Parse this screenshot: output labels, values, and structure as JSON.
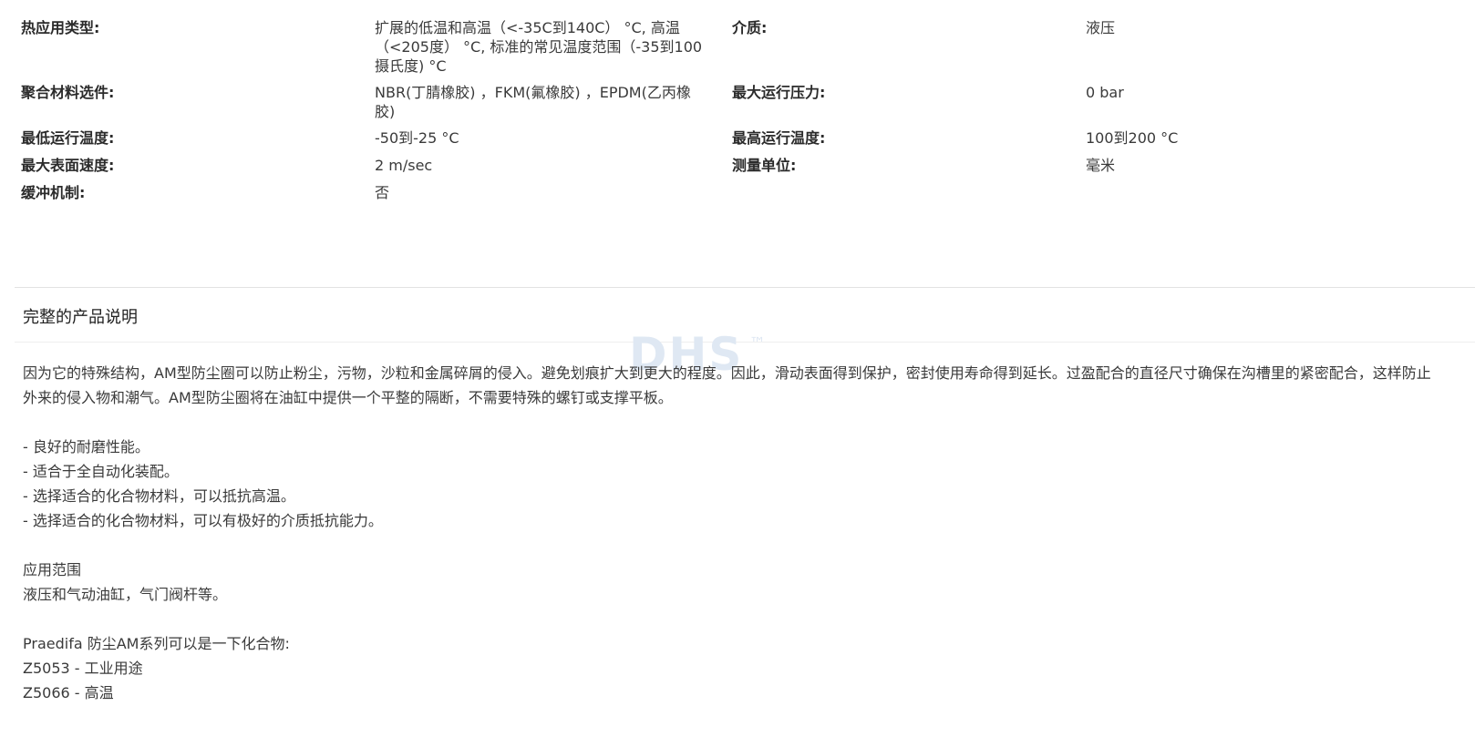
{
  "specs": [
    {
      "label1": "热应用类型:",
      "value1": "扩展的低温和高温（<-35C到140C） °C, 高温（<205度） °C, 标准的常见温度范围（-35到100摄氏度) °C",
      "label2": "介质:",
      "value2": "液压"
    },
    {
      "label1": "聚合材料选件:",
      "value1": "NBR(丁腈橡胶) ，FKM(氟橡胶) ，EPDM(乙丙橡胶)",
      "label2": "最大运行压力:",
      "value2": "0 bar"
    },
    {
      "label1": "最低运行温度:",
      "value1": "-50到-25 °C",
      "label2": "最高运行温度:",
      "value2": "100到200 °C"
    },
    {
      "label1": "最大表面速度:",
      "value1": "2 m/sec",
      "label2": "测量单位:",
      "value2": "毫米"
    },
    {
      "label1": "缓冲机制:",
      "value1": "否"
    }
  ],
  "section_title": "完整的产品说明",
  "watermark": "DHS",
  "watermark_tm": "™",
  "description": {
    "intro": "因为它的特殊结构，AM型防尘圈可以防止粉尘，污物，沙粒和金属碎屑的侵入。避免划痕扩大到更大的程度。因此，滑动表面得到保护，密封使用寿命得到延长。过盈配合的直径尺寸确保在沟槽里的紧密配合，这样防止外来的侵入物和潮气。AM型防尘圈将在油缸中提供一个平整的隔断，不需要特殊的螺钉或支撑平板。",
    "features": [
      " - 良好的耐磨性能。",
      " - 适合于全自动化装配。",
      " - 选择适合的化合物材料，可以抵抗高温。",
      " - 选择适合的化合物材料，可以有极好的介质抵抗能力。"
    ],
    "application_title": "应用范围",
    "application_text": "液压和气动油缸，气门阀杆等。",
    "compounds_title": "Praedifa 防尘AM系列可以是一下化合物:",
    "compounds": [
      "Z5053 - 工业用途",
      "Z5066 - 高温"
    ]
  }
}
